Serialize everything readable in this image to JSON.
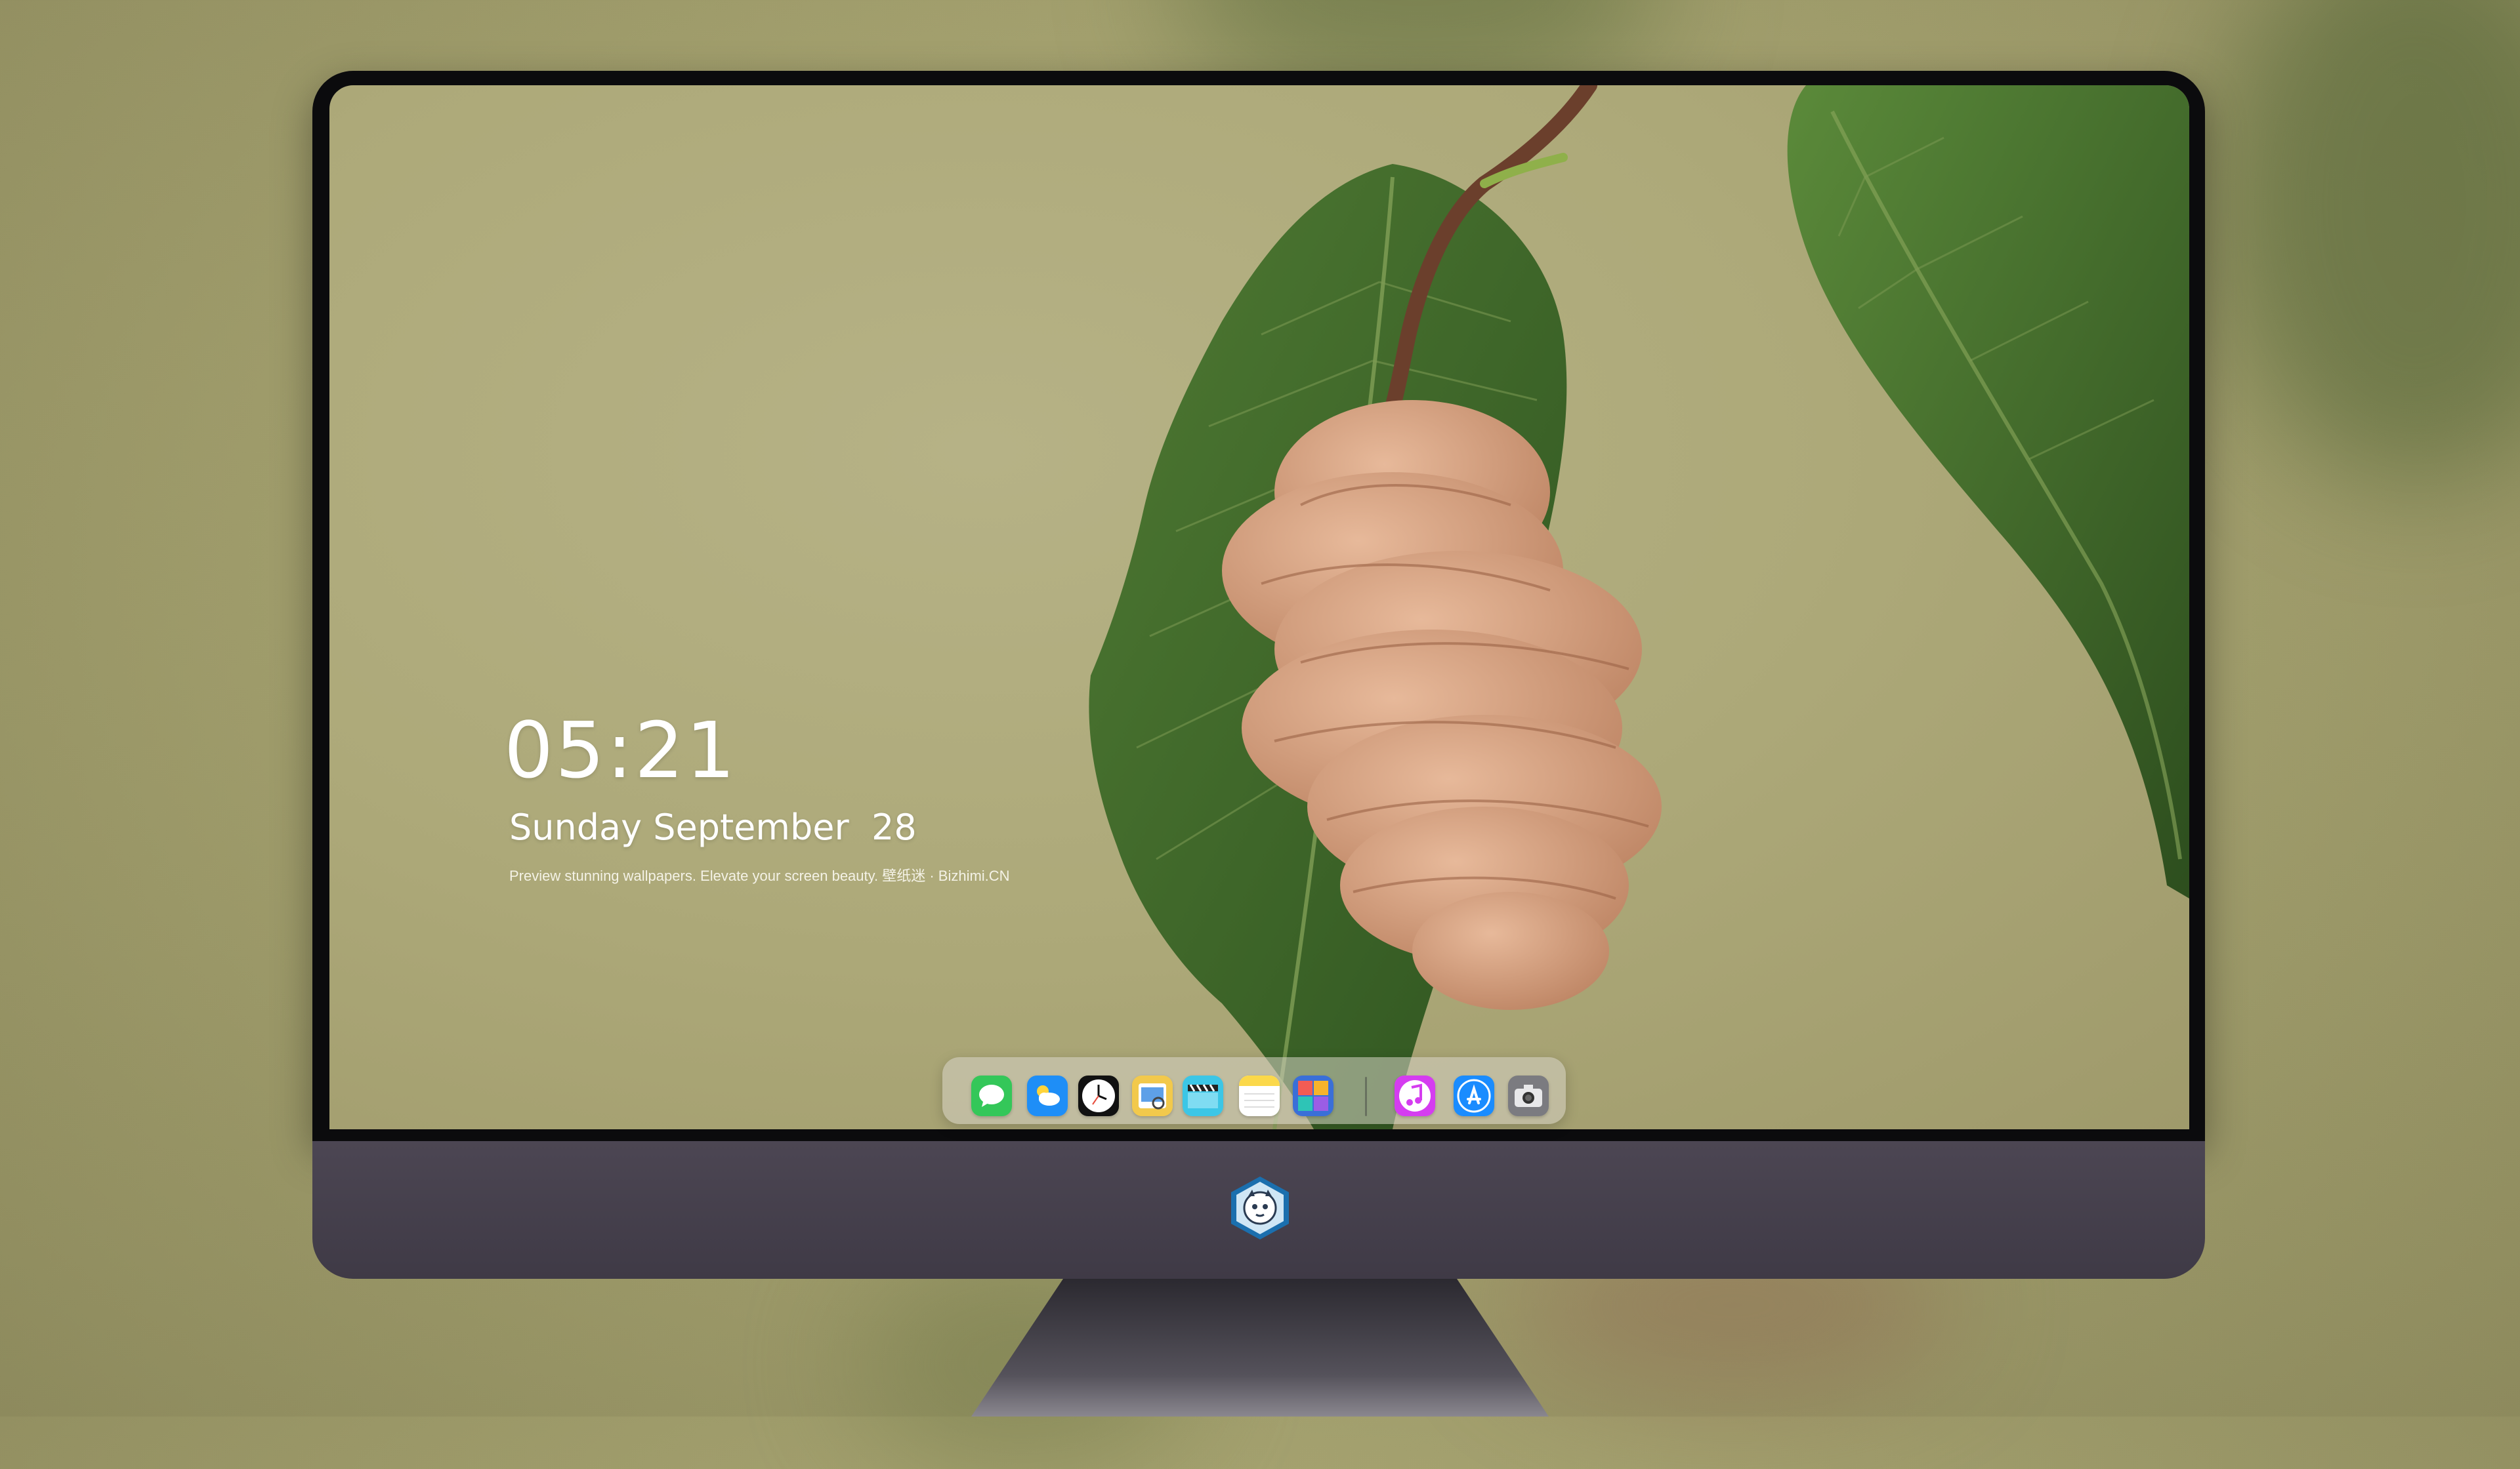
{
  "lockscreen": {
    "time": "05:21",
    "date": "Sunday September  28",
    "tagline": "Preview stunning wallpapers. Elevate your screen beauty. 壁纸迷 · Bizhimi.CN"
  },
  "dock": {
    "apps": [
      {
        "name": "messages-icon",
        "color": "#34c759"
      },
      {
        "name": "weather-icon",
        "color": "#1e8ef7"
      },
      {
        "name": "clock-icon",
        "color": "#111111"
      },
      {
        "name": "preview-icon",
        "color": "#f2c94c"
      },
      {
        "name": "clips-icon",
        "color": "#3cc6e6"
      },
      {
        "name": "notes-icon",
        "color": "#fbd84a"
      },
      {
        "name": "photo-booth-icon",
        "color": "#3a6fd8"
      },
      {
        "name": "music-icon",
        "color": "#d53cf0"
      },
      {
        "name": "app-store-icon",
        "color": "#1a8cff"
      },
      {
        "name": "camera-icon",
        "color": "#7b7b80"
      }
    ]
  },
  "monitor": {
    "logo": "mascot-logo-icon"
  }
}
